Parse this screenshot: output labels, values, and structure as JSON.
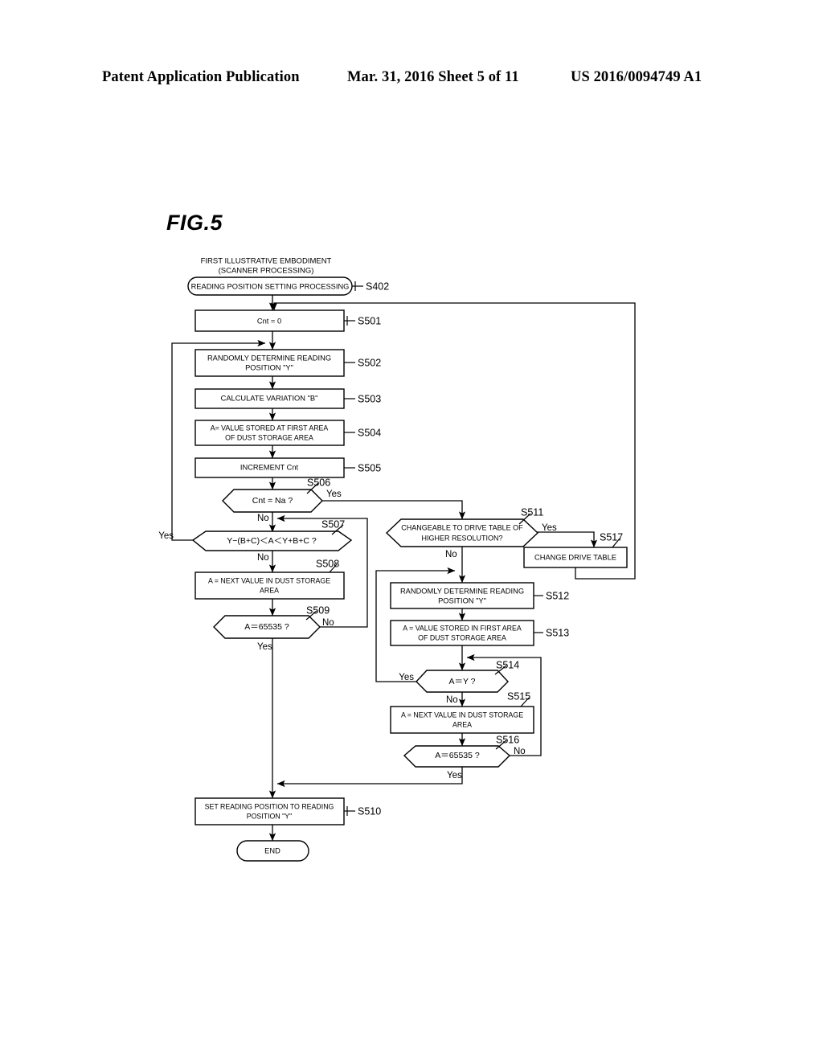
{
  "header": {
    "left": "Patent Application Publication",
    "middle": "Mar. 31, 2016  Sheet 5 of 11",
    "right": "US 2016/0094749 A1"
  },
  "figure": {
    "label": "FIG.5",
    "caption_line1": "FIRST ILLUSTRATIVE EMBODIMENT",
    "caption_line2": "(SCANNER PROCESSING)"
  },
  "flowchart": {
    "type": "flowchart",
    "nodes": [
      {
        "id": "S402",
        "shape": "terminator",
        "text": "READING POSITION SETTING PROCESSING",
        "lines": [
          "READING POSITION SETTING PROCESSING"
        ]
      },
      {
        "id": "S501",
        "shape": "process",
        "text": "Cnt = 0",
        "lines": [
          "Cnt = 0"
        ]
      },
      {
        "id": "S502",
        "shape": "process",
        "text": "RANDOMLY DETERMINE READING POSITION \"Y\"",
        "lines": [
          "RANDOMLY DETERMINE READING",
          "POSITION \"Y\""
        ]
      },
      {
        "id": "S503",
        "shape": "process",
        "text": "CALCULATE VARIATION \"B\"",
        "lines": [
          "CALCULATE VARIATION \"B\""
        ]
      },
      {
        "id": "S504",
        "shape": "process",
        "text": "A= VALUE STORED AT FIRST AREA OF DUST STORAGE AREA",
        "lines": [
          "A= VALUE STORED AT FIRST AREA",
          "OF DUST STORAGE AREA"
        ]
      },
      {
        "id": "S505",
        "shape": "process",
        "text": "INCREMENT Cnt",
        "lines": [
          "INCREMENT  Cnt"
        ]
      },
      {
        "id": "S506",
        "shape": "decision",
        "text": "Cnt = Na ?",
        "lines": [
          "Cnt = Na ?"
        ],
        "branches": [
          "Yes",
          "No"
        ]
      },
      {
        "id": "S507",
        "shape": "decision",
        "text": "Y−(B+C) < A < Y+B+C ?",
        "lines": [
          "Y−(B+C) < A < Y+B+C ?"
        ],
        "branches": [
          "Yes",
          "No"
        ]
      },
      {
        "id": "S508",
        "shape": "process",
        "text": "A = NEXT VALUE IN DUST STORAGE AREA",
        "lines": [
          "A = NEXT VALUE IN DUST STORAGE",
          "AREA"
        ]
      },
      {
        "id": "S509",
        "shape": "decision",
        "text": "A = 65535 ?",
        "lines": [
          "A＝65535 ?"
        ],
        "branches": [
          "No",
          "Yes"
        ]
      },
      {
        "id": "S510",
        "shape": "process",
        "text": "SET READING POSITION TO READING POSITION \"Y\"",
        "lines": [
          "SET READING POSITION TO READING",
          "POSITION \"Y\""
        ]
      },
      {
        "id": "S511",
        "shape": "decision",
        "text": "CHANGEABLE TO DRIVE TABLE OF HIGHER RESOLUTION?",
        "lines": [
          "CHANGEABLE TO DRIVE TABLE OF",
          "HIGHER RESOLUTION?"
        ],
        "branches": [
          "Yes",
          "No"
        ]
      },
      {
        "id": "S512",
        "shape": "process",
        "text": "RANDOMLY DETERMINE READING POSITION \"Y\"",
        "lines": [
          "RANDOMLY DETERMINE READING",
          "POSITION \"Y\""
        ]
      },
      {
        "id": "S513",
        "shape": "process",
        "text": "A = VALUE STORED IN FIRST AREA OF DUST STORAGE AREA",
        "lines": [
          "A = VALUE STORED IN FIRST AREA",
          "OF DUST STORAGE AREA"
        ]
      },
      {
        "id": "S514",
        "shape": "decision",
        "text": "A = Y ?",
        "lines": [
          "A＝Y ?"
        ],
        "branches": [
          "Yes",
          "No"
        ]
      },
      {
        "id": "S515",
        "shape": "process",
        "text": "A = NEXT VALUE IN DUST STORAGE AREA",
        "lines": [
          "A = NEXT VALUE IN DUST STORAGE",
          "AREA"
        ]
      },
      {
        "id": "S516",
        "shape": "decision",
        "text": "A = 65535 ?",
        "lines": [
          "A＝65535 ?"
        ],
        "branches": [
          "No",
          "Yes"
        ]
      },
      {
        "id": "S517",
        "shape": "process",
        "text": "CHANGE DRIVE TABLE",
        "lines": [
          "CHANGE DRIVE TABLE"
        ]
      },
      {
        "id": "END",
        "shape": "terminator",
        "text": "END",
        "lines": [
          "END"
        ]
      }
    ],
    "step_ids": {
      "s402": "S402",
      "s501": "S501",
      "s502": "S502",
      "s503": "S503",
      "s504": "S504",
      "s505": "S505",
      "s506": "S506",
      "s507": "S507",
      "s508": "S508",
      "s509": "S509",
      "s510": "S510",
      "s511": "S511",
      "s512": "S512",
      "s513": "S513",
      "s514": "S514",
      "s515": "S515",
      "s516": "S516",
      "s517": "S517"
    },
    "node_text": {
      "s402": "READING POSITION SETTING PROCESSING",
      "s501": "Cnt = 0",
      "s502_l1": "RANDOMLY DETERMINE READING",
      "s502_l2": "POSITION \"Y\"",
      "s503": "CALCULATE VARIATION \"B\"",
      "s504_l1": "A= VALUE STORED AT FIRST AREA",
      "s504_l2": "OF DUST STORAGE AREA",
      "s505": "INCREMENT  Cnt",
      "s506": "Cnt = Na ?",
      "s507": "Y−(B+C)＜A＜Y+B+C ?",
      "s508_l1": "A = NEXT VALUE IN DUST STORAGE",
      "s508_l2": "AREA",
      "s509": "A＝65535 ?",
      "s510_l1": "SET READING POSITION TO READING",
      "s510_l2": "POSITION \"Y\"",
      "s511_l1": "CHANGEABLE TO DRIVE TABLE OF",
      "s511_l2": "HIGHER RESOLUTION?",
      "s512_l1": "RANDOMLY DETERMINE READING",
      "s512_l2": "POSITION \"Y\"",
      "s513_l1": "A = VALUE STORED IN FIRST AREA",
      "s513_l2": "OF DUST STORAGE AREA",
      "s514": "A＝Y ?",
      "s515_l1": "A = NEXT VALUE IN DUST STORAGE",
      "s515_l2": "AREA",
      "s516": "A＝65535 ?",
      "s517": "CHANGE DRIVE TABLE",
      "end": "END"
    },
    "branch_labels": {
      "s506_yes": "Yes",
      "s506_no": "No",
      "s507_yes": "Yes",
      "s507_no": "No",
      "s509_no": "No",
      "s509_yes": "Yes",
      "s511_yes": "Yes",
      "s511_no": "No",
      "s514_yes": "Yes",
      "s514_no": "No",
      "s516_no": "No",
      "s516_yes": "Yes"
    },
    "edges": [
      {
        "from": "S402",
        "to": "S501",
        "label": ""
      },
      {
        "from": "S501",
        "to": "S502",
        "label": ""
      },
      {
        "from": "S502",
        "to": "S503",
        "label": ""
      },
      {
        "from": "S503",
        "to": "S504",
        "label": ""
      },
      {
        "from": "S504",
        "to": "S505",
        "label": ""
      },
      {
        "from": "S505",
        "to": "S506",
        "label": ""
      },
      {
        "from": "S506",
        "to": "S511",
        "label": "Yes"
      },
      {
        "from": "S506",
        "to": "S507",
        "label": "No"
      },
      {
        "from": "S507",
        "to": "S502",
        "label": "Yes"
      },
      {
        "from": "S507",
        "to": "S508",
        "label": "No"
      },
      {
        "from": "S508",
        "to": "S509",
        "label": ""
      },
      {
        "from": "S509",
        "to": "S507",
        "label": "No"
      },
      {
        "from": "S509",
        "to": "S510",
        "label": "Yes"
      },
      {
        "from": "S511",
        "to": "S517",
        "label": "Yes"
      },
      {
        "from": "S511",
        "to": "S512",
        "label": "No"
      },
      {
        "from": "S517",
        "to": "S501",
        "label": ""
      },
      {
        "from": "S512",
        "to": "S513",
        "label": ""
      },
      {
        "from": "S513",
        "to": "S514",
        "label": ""
      },
      {
        "from": "S514",
        "to": "S512",
        "label": "Yes"
      },
      {
        "from": "S514",
        "to": "S515",
        "label": "No"
      },
      {
        "from": "S515",
        "to": "S516",
        "label": ""
      },
      {
        "from": "S516",
        "to": "S514",
        "label": "No"
      },
      {
        "from": "S516",
        "to": "S510",
        "label": "Yes"
      },
      {
        "from": "S510",
        "to": "END",
        "label": ""
      }
    ]
  }
}
